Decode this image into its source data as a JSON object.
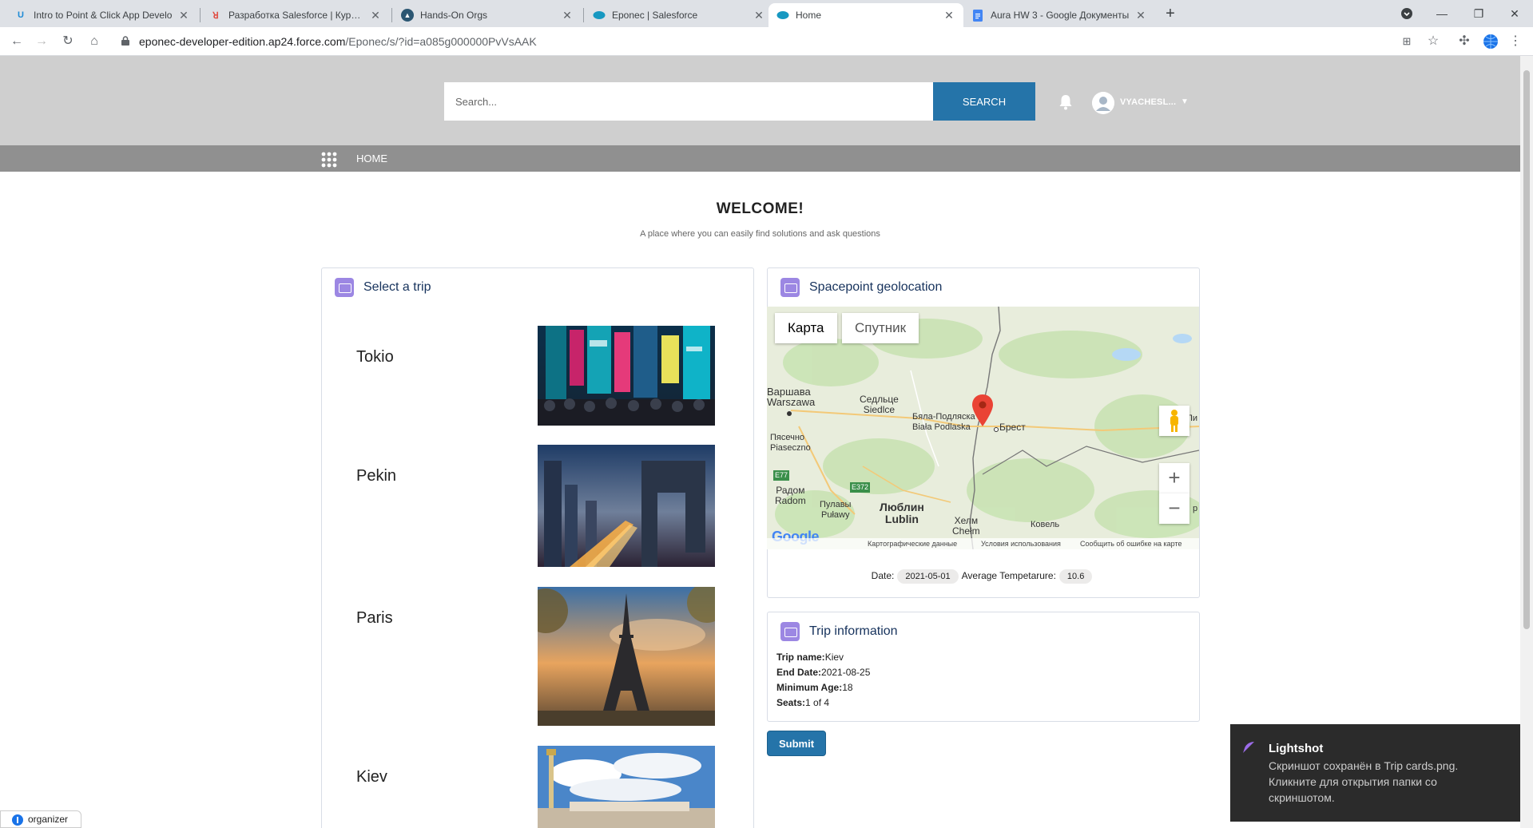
{
  "browser": {
    "tabs": [
      {
        "title": "Intro to Point & Click App Develo",
        "favicon": "trailhead-icon"
      },
      {
        "title": "Разработка Salesforce | Курсы и",
        "favicon": "course-icon"
      },
      {
        "title": "Hands-On Orgs",
        "favicon": "trailhead-org-icon"
      },
      {
        "title": "Eponec | Salesforce",
        "favicon": "salesforce-cloud-icon"
      },
      {
        "title": "Home",
        "favicon": "salesforce-cloud-icon",
        "active": true
      },
      {
        "title": "Aura HW 3 - Google Документы",
        "favicon": "google-docs-icon"
      }
    ],
    "url_host": "eponec-developer-edition.ap24.force.com",
    "url_path": "/Eponec/s/?id=a085g000000PvVsAAK"
  },
  "header": {
    "search_placeholder": "Search...",
    "search_button": "SEARCH",
    "user_name": "VYACHESL...",
    "nav_home": "HOME"
  },
  "page": {
    "title": "WELCOME!",
    "subtitle": "A place where you can easily find solutions and ask questions"
  },
  "select_trip": {
    "title": "Select a trip",
    "trips": [
      {
        "name": "Tokio"
      },
      {
        "name": "Pekin"
      },
      {
        "name": "Paris"
      },
      {
        "name": "Kiev"
      }
    ]
  },
  "geolocation": {
    "title": "Spacepoint geolocation",
    "map_tab_map": "Карта",
    "map_tab_satellite": "Спутник",
    "labels": {
      "warsaw": "Варшава\nWarszawa",
      "siedlce": "Седльце\nSiedlce",
      "biala": "Бяла-Подляска\nBiała Podlaska",
      "brest": "Брест",
      "piaseczno": "Пясечно\nPiaseczno",
      "radom": "Радом\nRadom",
      "pulawy": "Пулавы\nPuławy",
      "lublin": "Люблин\nLublin",
      "chelm": "Хелм\nChełm",
      "kovel": "Ковель",
      "e77": "E77",
      "e372": "E372",
      "pi": "Пи",
      "rp": "р"
    },
    "google": "Google",
    "footer": [
      "Картографические данные",
      "Условия использования",
      "Сообщить об ошибке на карте"
    ],
    "date_label": "Date:",
    "date_value": "2021-05-01",
    "temp_label": "Average Tempetarure:",
    "temp_value": "10.6"
  },
  "trip_info": {
    "title": "Trip information",
    "trip_name_label": "Trip name:",
    "trip_name": "Kiev",
    "end_date_label": "End Date:",
    "end_date": "2021-08-25",
    "min_age_label": "Minimum Age:",
    "min_age": "18",
    "seats_label": "Seats:",
    "seats": "1 of 4"
  },
  "submit_label": "Submit",
  "toast": {
    "title": "Lightshot",
    "message": "Скриншот сохранён в Trip cards.png. Кликните для открытия папки со скриншотом."
  },
  "organizer": "organizer",
  "colors": {
    "brand_blue": "#2574a9",
    "header_gray": "#cfcfcf",
    "nav_gray": "#909090",
    "card_icon_purple": "#9c87e3"
  }
}
